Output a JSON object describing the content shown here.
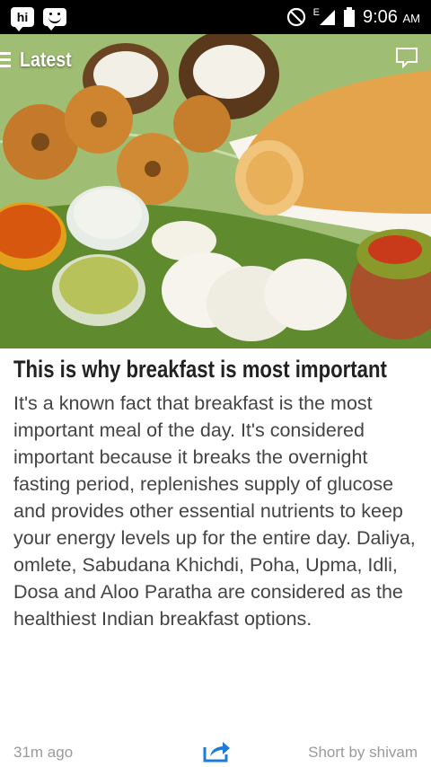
{
  "status_bar": {
    "app_badge_text": "hi",
    "network_type": "E",
    "time": "9:06",
    "time_suffix": "AM"
  },
  "toolbar": {
    "section_label": "Latest"
  },
  "article": {
    "headline": "This is why breakfast is most important",
    "body": "It's a known fact that breakfast is the most important meal of the day. It's considered important because it breaks the overnight fasting period, replenishes supply of glucose and provides other essential nutrients to keep your energy levels up for the entire day. Daliya, omlete, Sabudana Khichdi, Poha, Upma, Idli, Dosa and Aloo Paratha are considered as the healthiest Indian breakfast options."
  },
  "footer": {
    "time_ago": "31m ago",
    "author": "Short by shivam"
  },
  "colors": {
    "status_bar_bg": "#000000",
    "accent_blue": "#1f7bd6",
    "meta_text": "#9a9a9a"
  },
  "icons": [
    "hike-app-icon",
    "chat-smiley-icon",
    "dnd-icon",
    "signal-icon",
    "battery-icon",
    "hamburger-menu-icon",
    "comment-icon",
    "share-icon"
  ]
}
